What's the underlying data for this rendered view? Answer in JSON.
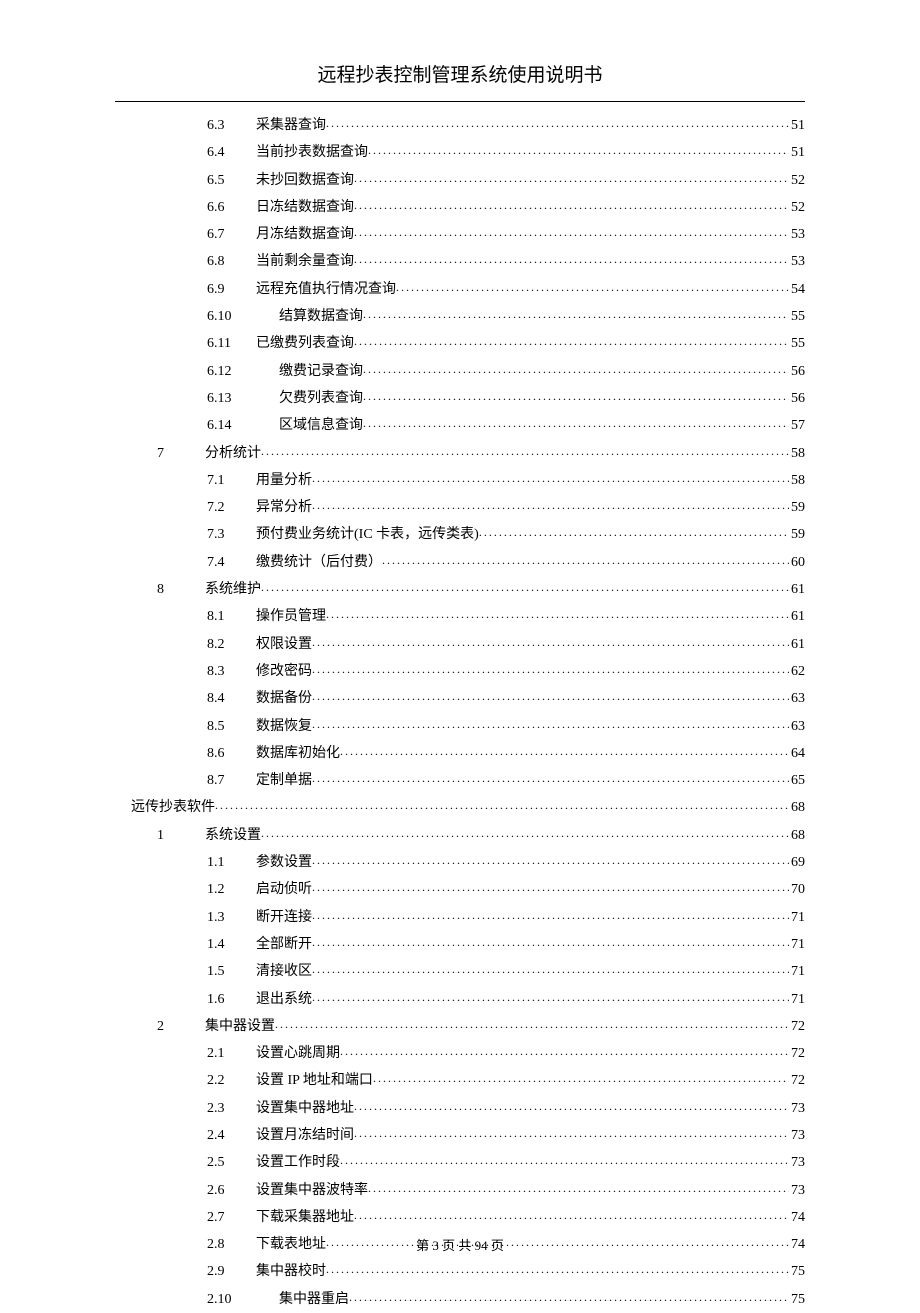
{
  "title": "远程抄表控制管理系统使用说明书",
  "footer": "第 3 页 共 94 页",
  "toc": [
    {
      "lvl": "lvl2",
      "num": "6.3",
      "label": "采集器查询",
      "pg": "51"
    },
    {
      "lvl": "lvl2",
      "num": "6.4",
      "label": "当前抄表数据查询",
      "pg": "51"
    },
    {
      "lvl": "lvl2",
      "num": "6.5",
      "label": "未抄回数据查询",
      "pg": "52"
    },
    {
      "lvl": "lvl2",
      "num": "6.6",
      "label": "日冻结数据查询",
      "pg": "52"
    },
    {
      "lvl": "lvl2",
      "num": "6.7",
      "label": "月冻结数据查询",
      "pg": "53"
    },
    {
      "lvl": "lvl2",
      "num": "6.8",
      "label": "当前剩余量查询",
      "pg": "53"
    },
    {
      "lvl": "lvl2",
      "num": "6.9",
      "label": "远程充值执行情况查询",
      "pg": "54"
    },
    {
      "lvl": "lvl2w",
      "num": "6.10",
      "label": "结算数据查询",
      "pg": "55"
    },
    {
      "lvl": "lvl2",
      "num": "6.11",
      "label": "已缴费列表查询",
      "pg": "55"
    },
    {
      "lvl": "lvl2w",
      "num": "6.12",
      "label": "缴费记录查询",
      "pg": "56"
    },
    {
      "lvl": "lvl2w",
      "num": "6.13",
      "label": "欠费列表查询",
      "pg": "56"
    },
    {
      "lvl": "lvl2w",
      "num": "6.14",
      "label": "区域信息查询",
      "pg": "57"
    },
    {
      "lvl": "lvl1",
      "num": "7",
      "label": "分析统计",
      "pg": "58"
    },
    {
      "lvl": "lvl2",
      "num": "7.1",
      "label": "用量分析",
      "pg": "58"
    },
    {
      "lvl": "lvl2",
      "num": "7.2",
      "label": "异常分析",
      "pg": "59"
    },
    {
      "lvl": "lvl2",
      "num": "7.3",
      "label": "预付费业务统计(IC 卡表，远传类表)",
      "pg": "59"
    },
    {
      "lvl": "lvl2",
      "num": "7.4",
      "label": "缴费统计（后付费）",
      "pg": "60"
    },
    {
      "lvl": "lvl1",
      "num": "8",
      "label": "系统维护",
      "pg": "61"
    },
    {
      "lvl": "lvl2",
      "num": "8.1",
      "label": "操作员管理",
      "pg": "61"
    },
    {
      "lvl": "lvl2",
      "num": "8.2",
      "label": "权限设置",
      "pg": "61"
    },
    {
      "lvl": "lvl2",
      "num": "8.3",
      "label": "修改密码",
      "pg": "62"
    },
    {
      "lvl": "lvl2",
      "num": "8.4",
      "label": "数据备份",
      "pg": "63"
    },
    {
      "lvl": "lvl2",
      "num": "8.5",
      "label": "数据恢复",
      "pg": "63"
    },
    {
      "lvl": "lvl2",
      "num": "8.6",
      "label": "数据库初始化",
      "pg": "64"
    },
    {
      "lvl": "lvl2",
      "num": "8.7",
      "label": "定制单据",
      "pg": "65"
    },
    {
      "lvl": "lvl0",
      "num": "",
      "label": "远传抄表软件",
      "pg": "68"
    },
    {
      "lvl": "lvl1",
      "num": "1",
      "label": "系统设置",
      "pg": "68"
    },
    {
      "lvl": "lvl2",
      "num": "1.1",
      "label": "参数设置",
      "pg": "69"
    },
    {
      "lvl": "lvl2",
      "num": "1.2",
      "label": "启动侦听",
      "pg": "70"
    },
    {
      "lvl": "lvl2",
      "num": "1.3",
      "label": "断开连接",
      "pg": "71"
    },
    {
      "lvl": "lvl2",
      "num": "1.4",
      "label": "全部断开",
      "pg": "71"
    },
    {
      "lvl": "lvl2",
      "num": "1.5",
      "label": "清接收区",
      "pg": "71"
    },
    {
      "lvl": "lvl2",
      "num": "1.6",
      "label": "退出系统",
      "pg": "71"
    },
    {
      "lvl": "lvl1",
      "num": "2",
      "label": "集中器设置",
      "pg": "72"
    },
    {
      "lvl": "lvl2",
      "num": "2.1",
      "label": "设置心跳周期",
      "pg": "72"
    },
    {
      "lvl": "lvl2",
      "num": "2.2",
      "label": "设置 IP 地址和端口",
      "pg": "72"
    },
    {
      "lvl": "lvl2",
      "num": "2.3",
      "label": "设置集中器地址",
      "pg": "73"
    },
    {
      "lvl": "lvl2",
      "num": "2.4",
      "label": "设置月冻结时间",
      "pg": "73"
    },
    {
      "lvl": "lvl2",
      "num": "2.5",
      "label": "设置工作时段",
      "pg": "73"
    },
    {
      "lvl": "lvl2",
      "num": "2.6",
      "label": "设置集中器波特率",
      "pg": "73"
    },
    {
      "lvl": "lvl2",
      "num": "2.7",
      "label": "下载采集器地址",
      "pg": "74"
    },
    {
      "lvl": "lvl2",
      "num": "2.8",
      "label": "下载表地址",
      "pg": "74"
    },
    {
      "lvl": "lvl2",
      "num": "2.9",
      "label": "集中器校时",
      "pg": "75"
    },
    {
      "lvl": "lvl2w",
      "num": "2.10",
      "label": "集中器重启",
      "pg": "75"
    }
  ]
}
